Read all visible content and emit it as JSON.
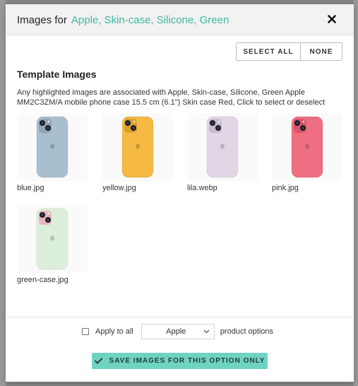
{
  "modal": {
    "title_prefix": "Images for",
    "title_accent": "Apple, Skin-case, Silicone, Green"
  },
  "selection": {
    "select_all_label": "SELECT ALL",
    "none_label": "NONE"
  },
  "section": {
    "title": "Template Images",
    "description": "Any highlighted images are associated with Apple, Skin-case, Silicone, Green Apple MM2C3ZM/A mobile phone case 15.5 cm (6.1\") Skin case Red, Click to select or deselect"
  },
  "images": [
    {
      "caption": "blue.jpg",
      "color": "#a8bfd0",
      "camera": "#8fa5b6"
    },
    {
      "caption": "yellow.jpg",
      "color": "#f5b944",
      "camera": "#d99e2c"
    },
    {
      "caption": "lila.webp",
      "color": "#e2d6e6",
      "camera": "#c9b9ce"
    },
    {
      "caption": "pink.jpg",
      "color": "#ef6f82",
      "camera": "#d85468"
    },
    {
      "caption": "green-case.jpg",
      "color": "#dcefdb",
      "camera": "#e7b5c2"
    }
  ],
  "footer": {
    "apply_label": "Apply to all",
    "brand_select_value": "Apple",
    "suffix_label": "product options",
    "save_label": "SAVE IMAGES FOR THIS OPTION ONLY"
  },
  "colors": {
    "accent": "#3fb8a3",
    "save_button": "#6fd3c1"
  }
}
